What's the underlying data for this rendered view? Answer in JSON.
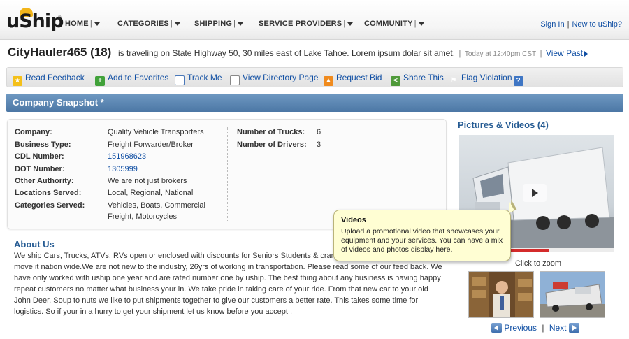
{
  "brand": {
    "logo_text": "uShip",
    "trademark": "®"
  },
  "nav": {
    "items": [
      "HOME",
      "CATEGORIES",
      "SHIPPING",
      "SERVICE PROVIDERS",
      "COMMUNITY"
    ],
    "separator": "|"
  },
  "account": {
    "sign_in": "Sign In",
    "separator": "|",
    "new_user": "New to uShip?"
  },
  "profile": {
    "username": "CityHauler465 (18)",
    "status": "is traveling on State Highway 50, 30 miles east of Lake Tahoe. Lorem ipsum dolar sit amet.",
    "pipe": "|",
    "timestamp": "Today at 12:40pm CST",
    "view_past": "View Past"
  },
  "actions": [
    {
      "label": "Read Feedback",
      "icon": "star-icon"
    },
    {
      "label": "Add to Favorites",
      "icon": "plus-icon"
    },
    {
      "label": "Track Me",
      "icon": "target-icon"
    },
    {
      "label": "View Directory Page",
      "icon": "directory-icon"
    },
    {
      "label": "Request Bid",
      "icon": "bid-icon"
    },
    {
      "label": "Share This",
      "icon": "share-icon"
    },
    {
      "label": "Flag Violation",
      "icon": "flag-icon"
    }
  ],
  "snapshot": {
    "title": "Company Snapshot *",
    "left": [
      {
        "label": "Company:",
        "value": "Quality Vehicle Transporters"
      },
      {
        "label": "Business Type:",
        "value": "Freight Forwarder/Broker"
      },
      {
        "label": "CDL Number:",
        "value": "151968623"
      },
      {
        "label": "DOT Number:",
        "value": "1305999"
      },
      {
        "label": "Other Authority:",
        "value": "We are not just brokers"
      },
      {
        "label": "Locations Served:",
        "value": "Local, Regional, National"
      },
      {
        "label": "Categories Served:",
        "value": "Vehicles, Boats, Commercial",
        "value2": "Freight, Motorcycles"
      }
    ],
    "right": [
      {
        "label": "Number of Trucks:",
        "value": "6"
      },
      {
        "label": "Number of Drivers:",
        "value": "3"
      }
    ]
  },
  "media": {
    "title": "Pictures & Videos (4)",
    "video_progress": 0.58,
    "click_to_zoom": "Click to zoom",
    "previous": "Previous",
    "pager_sep": "|",
    "next": "Next"
  },
  "about": {
    "title": "About Us",
    "text": "We ship Cars, Trucks, ATVs, RVs open or enclosed with discounts for Seniors Students & cranes tanks tractors if it moves we move it nation wide.We are not new to the industry, 26yrs of working in transportation. Please read some of our feed back. We have only worked with uship one year and are rated number one by uship. The best thing about any business is having happy repeat customers no matter what business your in. We take pride in taking care of your ride. From that new car to your old John Deer. Soup to nuts we like to put shipments together to give our customers a better rate. This takes some time for logistics. So if your in a hurry to get your shipment let us know before you accept ."
  },
  "tooltip": {
    "title": "Videos",
    "body": "Upload a promotional video that showcases your equipment and your services. You can have a mix of videos and photos display here."
  }
}
